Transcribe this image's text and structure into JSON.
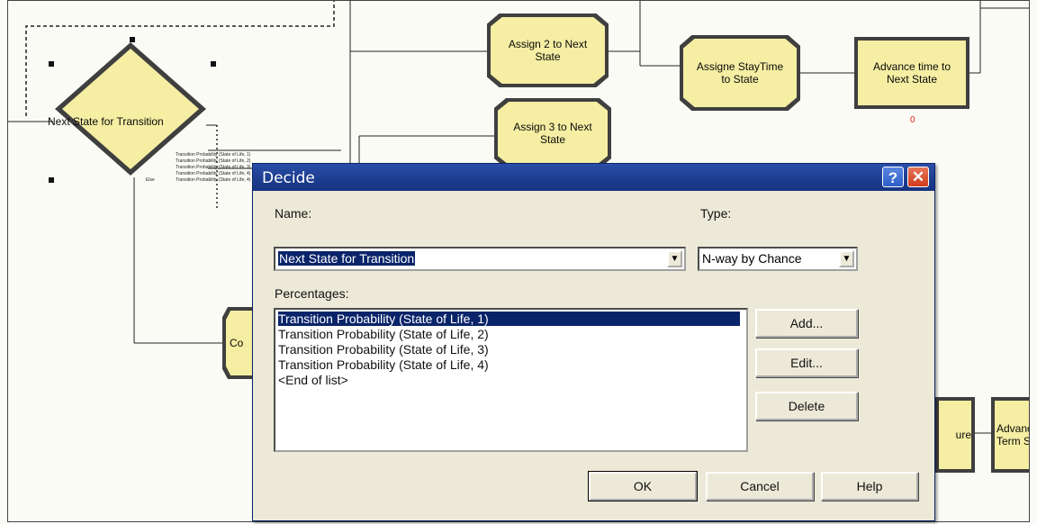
{
  "flowchart": {
    "decide_label": "Next State for Transition",
    "branch_labels": [
      "Transition Probability (State of Life, 1)",
      "Transition Probability (State of Life, 2)",
      "Transition Probability (State of Life, 3)",
      "Transition Probability (State of Life, 4)",
      "Transition Probability (State of Life, 4)"
    ],
    "else_label": "Else",
    "assign2": "Assign 2 to Next State",
    "assign3": "Assign 3 to Next State",
    "assigne": "Assigne StayTime to State",
    "advance": "Advance time to Next State",
    "advance_counter": "0",
    "bottom_left_module": "Co",
    "bottom_mid_module": "ure",
    "bottom_right_module": "Advanc Term S"
  },
  "dialog": {
    "title": "Decide",
    "help_glyph": "?",
    "close_glyph": "✕",
    "name_label": "Name:",
    "name_value": "Next State for Transition",
    "type_label": "Type:",
    "type_value": "N-way by Chance",
    "percentages_label": "Percentages:",
    "percentages": [
      "Transition Probability (State of Life, 1)",
      "Transition Probability (State of Life, 2)",
      "Transition Probability (State of Life, 3)",
      "Transition Probability (State of Life, 4)",
      "<End of list>"
    ],
    "add_label": "Add...",
    "edit_label": "Edit...",
    "delete_label": "Delete",
    "ok_label": "OK",
    "cancel_label": "Cancel",
    "help_label": "Help",
    "dropdown_glyph": "▼"
  },
  "colors": {
    "module_fill": "#f5eea3",
    "title_bar": "#1c3c8e",
    "selection": "#0a246a",
    "close": "#cf3c1c"
  }
}
